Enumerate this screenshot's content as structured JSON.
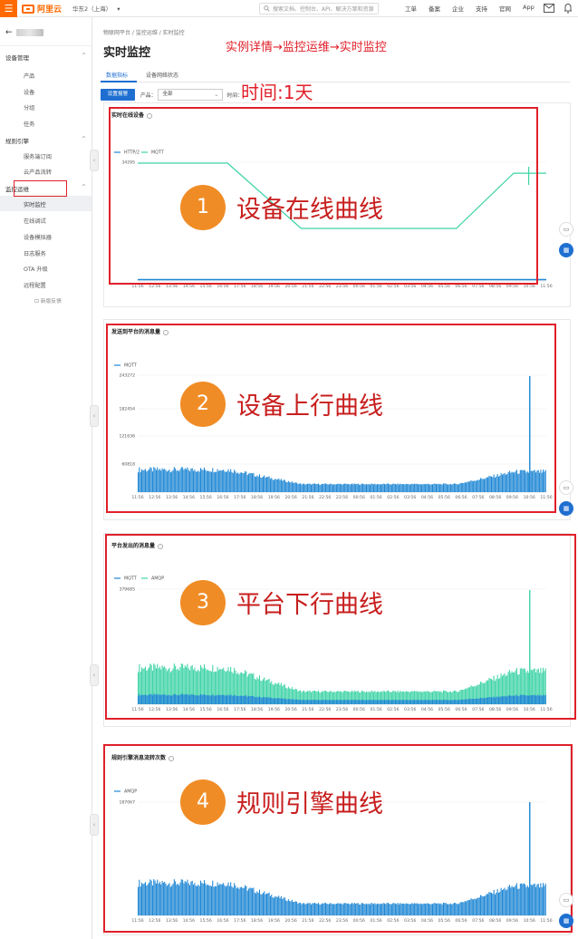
{
  "topbar": {
    "menu_icon": "hamburger-icon",
    "logo_text": "阿里云",
    "region": "华东2（上海）",
    "region_caret": "▾",
    "search_placeholder": "搜索文档、控制台、API、解决方案和资源",
    "nav": [
      "工单",
      "备案",
      "企业",
      "支持",
      "官网",
      "App"
    ]
  },
  "sidebar": {
    "back_arrow": "←",
    "groups": [
      {
        "title": "设备管理",
        "caret": "^",
        "items": [
          "产品",
          "设备",
          "分组",
          "任务"
        ]
      },
      {
        "title": "规则引擎",
        "caret": "^",
        "items": [
          "服务端订阅",
          "云产品流转"
        ]
      },
      {
        "title": "监控运维",
        "caret": "^",
        "items": [
          "实时监控",
          "在线调试",
          "设备模拟器",
          "日志服务",
          "OTA 升级",
          "远程配置"
        ]
      }
    ],
    "active_item": "实时监控",
    "feedback": "新版反馈"
  },
  "main": {
    "breadcrumb": "物联网平台  /  监控运维  /  实时监控",
    "title": "实时监控",
    "annotation_path": "实例详情→监控运维→实时监控",
    "annotation_time": "时间:1天",
    "tabs": [
      "数据指标",
      "设备网络状态"
    ],
    "filter": {
      "button": "设置报警",
      "product_label": "产品：",
      "product_value": "全部",
      "time_label": "时间："
    }
  },
  "charts_meta": {
    "colors": {
      "teal": "#3ed3a6",
      "blue": "#1d86d4"
    },
    "time_ticks": [
      "11:56",
      "12:56",
      "13:56",
      "14:56",
      "15:56",
      "16:56",
      "17:56",
      "18:56",
      "19:56",
      "20:56",
      "21:56",
      "22:56",
      "23:56",
      "00:56",
      "01:56",
      "02:56",
      "03:56",
      "04:56",
      "05:56",
      "06:56",
      "07:56",
      "08:56",
      "09:56",
      "10:56",
      "11:56"
    ]
  },
  "annotations": [
    {
      "num": "1",
      "label": "设备在线曲线"
    },
    {
      "num": "2",
      "label": "设备上行曲线"
    },
    {
      "num": "3",
      "label": "平台下行曲线"
    },
    {
      "num": "4",
      "label": "规则引擎曲线"
    }
  ],
  "chart_data": [
    {
      "type": "line",
      "title": "实时在线设备",
      "legend": [
        "HTTP/2",
        "MQTT"
      ],
      "yticks": [
        "34295"
      ],
      "series": [
        {
          "name": "MQTT",
          "color": "#3ed3a6",
          "shape": "online"
        },
        {
          "name": "HTTP/2",
          "color": "#1d86d4",
          "shape": "flat"
        }
      ]
    },
    {
      "type": "area",
      "title": "发送到平台的消息量",
      "legend": [
        "MQTT"
      ],
      "yticks": [
        "243272",
        "182454",
        "121636",
        "60818"
      ],
      "series": [
        {
          "name": "MQTT",
          "color": "#1d86d4",
          "shape": "dense",
          "peak": 243272
        }
      ]
    },
    {
      "type": "area",
      "title": "平台发出的消息量",
      "legend": [
        "MQTT",
        "AMQP"
      ],
      "yticks": [
        "379685"
      ],
      "series": [
        {
          "name": "AMQP",
          "color": "#3ed3a6",
          "shape": "dense-tall"
        },
        {
          "name": "MQTT",
          "color": "#1d86d4",
          "shape": "dense-low"
        }
      ]
    },
    {
      "type": "area",
      "title": "规则引擎消息流转次数",
      "legend": [
        "AMQP"
      ],
      "yticks": [
        "187067"
      ],
      "series": [
        {
          "name": "AMQP",
          "color": "#1d86d4",
          "shape": "dense"
        }
      ]
    }
  ]
}
